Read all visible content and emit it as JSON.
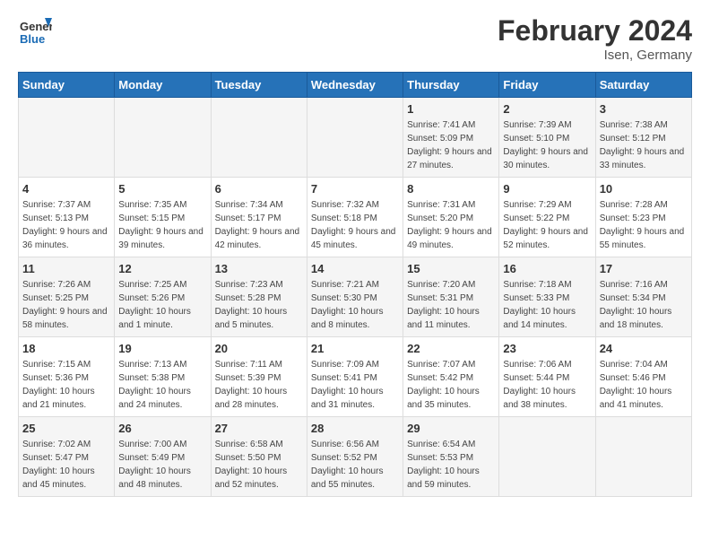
{
  "logo": {
    "line1": "General",
    "line2": "Blue"
  },
  "title": "February 2024",
  "location": "Isen, Germany",
  "days_of_week": [
    "Sunday",
    "Monday",
    "Tuesday",
    "Wednesday",
    "Thursday",
    "Friday",
    "Saturday"
  ],
  "weeks": [
    {
      "days": [
        {
          "number": "",
          "info": ""
        },
        {
          "number": "",
          "info": ""
        },
        {
          "number": "",
          "info": ""
        },
        {
          "number": "",
          "info": ""
        },
        {
          "number": "1",
          "info": "Sunrise: 7:41 AM\nSunset: 5:09 PM\nDaylight: 9 hours and 27 minutes."
        },
        {
          "number": "2",
          "info": "Sunrise: 7:39 AM\nSunset: 5:10 PM\nDaylight: 9 hours and 30 minutes."
        },
        {
          "number": "3",
          "info": "Sunrise: 7:38 AM\nSunset: 5:12 PM\nDaylight: 9 hours and 33 minutes."
        }
      ]
    },
    {
      "days": [
        {
          "number": "4",
          "info": "Sunrise: 7:37 AM\nSunset: 5:13 PM\nDaylight: 9 hours and 36 minutes."
        },
        {
          "number": "5",
          "info": "Sunrise: 7:35 AM\nSunset: 5:15 PM\nDaylight: 9 hours and 39 minutes."
        },
        {
          "number": "6",
          "info": "Sunrise: 7:34 AM\nSunset: 5:17 PM\nDaylight: 9 hours and 42 minutes."
        },
        {
          "number": "7",
          "info": "Sunrise: 7:32 AM\nSunset: 5:18 PM\nDaylight: 9 hours and 45 minutes."
        },
        {
          "number": "8",
          "info": "Sunrise: 7:31 AM\nSunset: 5:20 PM\nDaylight: 9 hours and 49 minutes."
        },
        {
          "number": "9",
          "info": "Sunrise: 7:29 AM\nSunset: 5:22 PM\nDaylight: 9 hours and 52 minutes."
        },
        {
          "number": "10",
          "info": "Sunrise: 7:28 AM\nSunset: 5:23 PM\nDaylight: 9 hours and 55 minutes."
        }
      ]
    },
    {
      "days": [
        {
          "number": "11",
          "info": "Sunrise: 7:26 AM\nSunset: 5:25 PM\nDaylight: 9 hours and 58 minutes."
        },
        {
          "number": "12",
          "info": "Sunrise: 7:25 AM\nSunset: 5:26 PM\nDaylight: 10 hours and 1 minute."
        },
        {
          "number": "13",
          "info": "Sunrise: 7:23 AM\nSunset: 5:28 PM\nDaylight: 10 hours and 5 minutes."
        },
        {
          "number": "14",
          "info": "Sunrise: 7:21 AM\nSunset: 5:30 PM\nDaylight: 10 hours and 8 minutes."
        },
        {
          "number": "15",
          "info": "Sunrise: 7:20 AM\nSunset: 5:31 PM\nDaylight: 10 hours and 11 minutes."
        },
        {
          "number": "16",
          "info": "Sunrise: 7:18 AM\nSunset: 5:33 PM\nDaylight: 10 hours and 14 minutes."
        },
        {
          "number": "17",
          "info": "Sunrise: 7:16 AM\nSunset: 5:34 PM\nDaylight: 10 hours and 18 minutes."
        }
      ]
    },
    {
      "days": [
        {
          "number": "18",
          "info": "Sunrise: 7:15 AM\nSunset: 5:36 PM\nDaylight: 10 hours and 21 minutes."
        },
        {
          "number": "19",
          "info": "Sunrise: 7:13 AM\nSunset: 5:38 PM\nDaylight: 10 hours and 24 minutes."
        },
        {
          "number": "20",
          "info": "Sunrise: 7:11 AM\nSunset: 5:39 PM\nDaylight: 10 hours and 28 minutes."
        },
        {
          "number": "21",
          "info": "Sunrise: 7:09 AM\nSunset: 5:41 PM\nDaylight: 10 hours and 31 minutes."
        },
        {
          "number": "22",
          "info": "Sunrise: 7:07 AM\nSunset: 5:42 PM\nDaylight: 10 hours and 35 minutes."
        },
        {
          "number": "23",
          "info": "Sunrise: 7:06 AM\nSunset: 5:44 PM\nDaylight: 10 hours and 38 minutes."
        },
        {
          "number": "24",
          "info": "Sunrise: 7:04 AM\nSunset: 5:46 PM\nDaylight: 10 hours and 41 minutes."
        }
      ]
    },
    {
      "days": [
        {
          "number": "25",
          "info": "Sunrise: 7:02 AM\nSunset: 5:47 PM\nDaylight: 10 hours and 45 minutes."
        },
        {
          "number": "26",
          "info": "Sunrise: 7:00 AM\nSunset: 5:49 PM\nDaylight: 10 hours and 48 minutes."
        },
        {
          "number": "27",
          "info": "Sunrise: 6:58 AM\nSunset: 5:50 PM\nDaylight: 10 hours and 52 minutes."
        },
        {
          "number": "28",
          "info": "Sunrise: 6:56 AM\nSunset: 5:52 PM\nDaylight: 10 hours and 55 minutes."
        },
        {
          "number": "29",
          "info": "Sunrise: 6:54 AM\nSunset: 5:53 PM\nDaylight: 10 hours and 59 minutes."
        },
        {
          "number": "",
          "info": ""
        },
        {
          "number": "",
          "info": ""
        }
      ]
    }
  ]
}
